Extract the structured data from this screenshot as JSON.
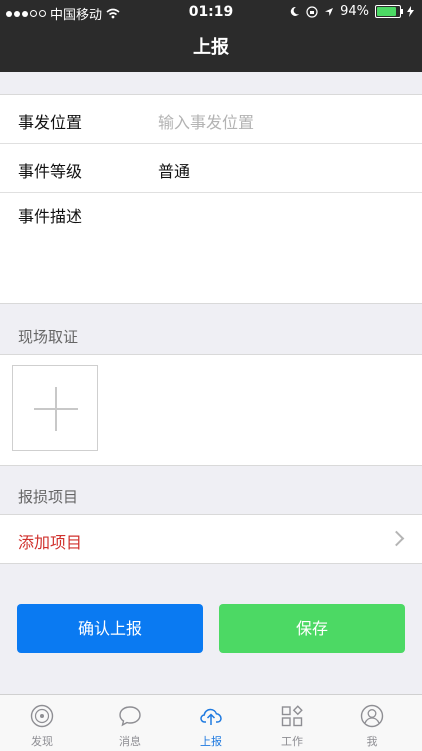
{
  "status": {
    "carrier": "中国移动",
    "time": "01:19",
    "battery": "94%",
    "battery_level": 0.94
  },
  "nav": {
    "title": "上报"
  },
  "form": {
    "location_label": "事发位置",
    "location_placeholder": "输入事发位置",
    "level_label": "事件等级",
    "level_value": "普通",
    "desc_label": "事件描述"
  },
  "evidence": {
    "header": "现场取证"
  },
  "damage": {
    "header": "报损项目",
    "add_label": "添加项目"
  },
  "buttons": {
    "confirm": "确认上报",
    "save": "保存"
  },
  "tabs": [
    {
      "label": "发现",
      "icon": "compass-icon"
    },
    {
      "label": "消息",
      "icon": "chat-bubble-icon"
    },
    {
      "label": "上报",
      "icon": "cloud-upload-icon"
    },
    {
      "label": "工作",
      "icon": "grid-apps-icon"
    },
    {
      "label": "我",
      "icon": "user-icon"
    }
  ],
  "colors": {
    "primary": "#0a7af2",
    "success": "#4cd964",
    "danger": "#d0312d",
    "nav": "#2b2b2b"
  }
}
